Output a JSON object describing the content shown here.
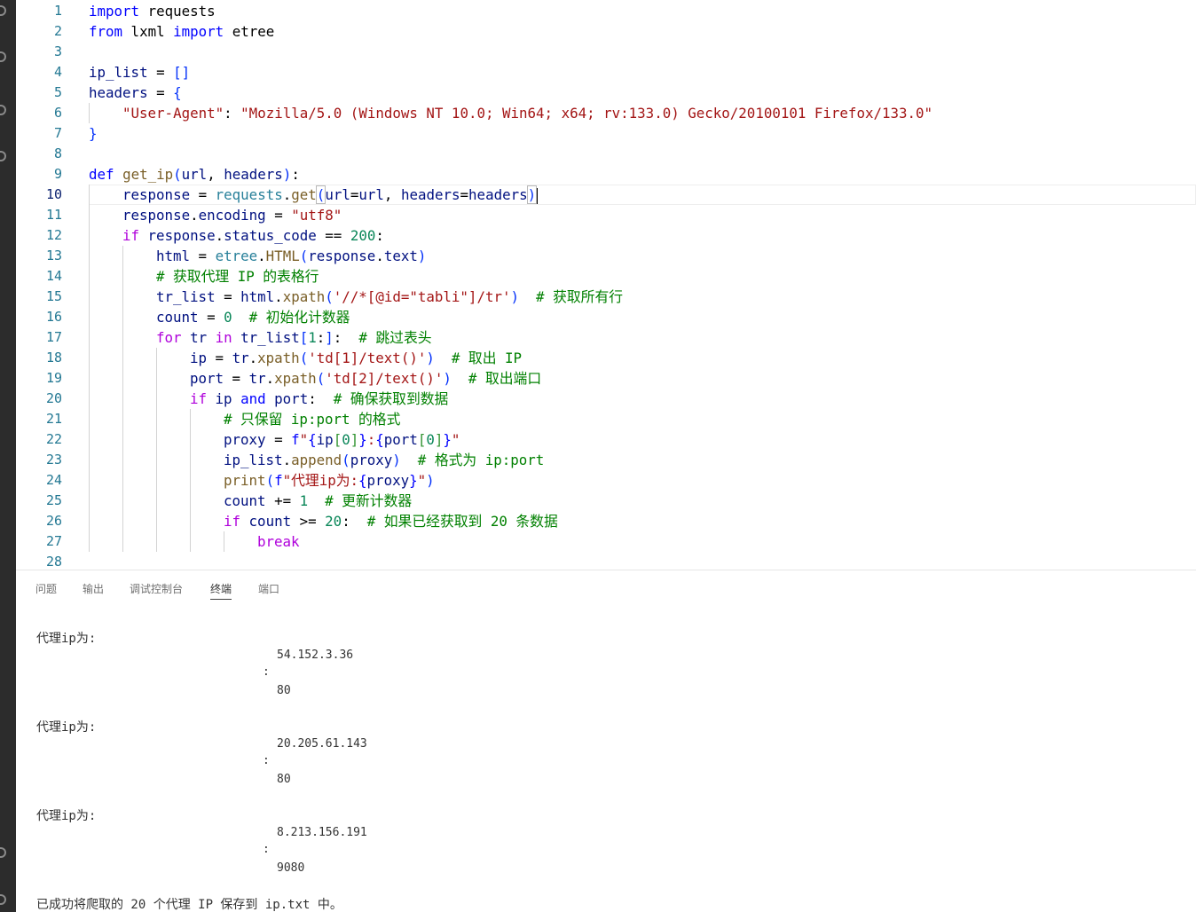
{
  "editor": {
    "active_line": 10,
    "lines": [
      {
        "n": "1",
        "indent": 0,
        "tokens": [
          [
            "kw",
            "import"
          ],
          [
            "",
            " "
          ],
          [
            "",
            "requests"
          ]
        ]
      },
      {
        "n": "2",
        "indent": 0,
        "tokens": [
          [
            "kw",
            "from"
          ],
          [
            "",
            " lxml "
          ],
          [
            "kw",
            "import"
          ],
          [
            "",
            " etree"
          ]
        ]
      },
      {
        "n": "3",
        "indent": 0,
        "tokens": []
      },
      {
        "n": "4",
        "indent": 0,
        "tokens": [
          [
            "var",
            "ip_list"
          ],
          [
            "",
            " = "
          ],
          [
            "br1",
            "[]"
          ]
        ]
      },
      {
        "n": "5",
        "indent": 0,
        "tokens": [
          [
            "var",
            "headers"
          ],
          [
            "",
            " = "
          ],
          [
            "br1",
            "{"
          ]
        ]
      },
      {
        "n": "6",
        "indent": 1,
        "tokens": [
          [
            "str",
            "\"User-Agent\""
          ],
          [
            "",
            ": "
          ],
          [
            "str",
            "\"Mozilla/5.0 (Windows NT 10.0; Win64; x64; rv:133.0) Gecko/20100101 Firefox/133.0\""
          ]
        ]
      },
      {
        "n": "7",
        "indent": 0,
        "tokens": [
          [
            "br1",
            "}"
          ]
        ]
      },
      {
        "n": "8",
        "indent": 0,
        "tokens": []
      },
      {
        "n": "9",
        "indent": 0,
        "tokens": [
          [
            "kw",
            "def"
          ],
          [
            "",
            " "
          ],
          [
            "fn",
            "get_ip"
          ],
          [
            "br1",
            "("
          ],
          [
            "var",
            "url"
          ],
          [
            "",
            ", "
          ],
          [
            "var",
            "headers"
          ],
          [
            "br1",
            ")"
          ],
          [
            "",
            ":"
          ]
        ]
      },
      {
        "n": "10",
        "indent": 1,
        "tokens": [
          [
            "var",
            "response"
          ],
          [
            "",
            " = "
          ],
          [
            "mod",
            "requests"
          ],
          [
            "",
            "."
          ],
          [
            "fn",
            "get"
          ],
          [
            "br1 mbox",
            "("
          ],
          [
            "var",
            "url"
          ],
          [
            "",
            "="
          ],
          [
            "var",
            "url"
          ],
          [
            "",
            ", "
          ],
          [
            "var",
            "headers"
          ],
          [
            "",
            "="
          ],
          [
            "var",
            "headers"
          ],
          [
            "br1 mbox",
            ")"
          ]
        ]
      },
      {
        "n": "11",
        "indent": 1,
        "tokens": [
          [
            "var",
            "response"
          ],
          [
            "",
            "."
          ],
          [
            "var",
            "encoding"
          ],
          [
            "",
            " = "
          ],
          [
            "str",
            "\"utf8\""
          ]
        ]
      },
      {
        "n": "12",
        "indent": 1,
        "tokens": [
          [
            "ctl",
            "if"
          ],
          [
            "",
            " "
          ],
          [
            "var",
            "response"
          ],
          [
            "",
            "."
          ],
          [
            "var",
            "status_code"
          ],
          [
            "",
            " == "
          ],
          [
            "num",
            "200"
          ],
          [
            "",
            ":"
          ]
        ]
      },
      {
        "n": "13",
        "indent": 2,
        "tokens": [
          [
            "var",
            "html"
          ],
          [
            "",
            " = "
          ],
          [
            "mod",
            "etree"
          ],
          [
            "",
            "."
          ],
          [
            "fn",
            "HTML"
          ],
          [
            "br1",
            "("
          ],
          [
            "var",
            "response"
          ],
          [
            "",
            "."
          ],
          [
            "var",
            "text"
          ],
          [
            "br1",
            ")"
          ]
        ]
      },
      {
        "n": "14",
        "indent": 2,
        "tokens": [
          [
            "cmt",
            "# 获取代理 IP 的表格行"
          ]
        ]
      },
      {
        "n": "15",
        "indent": 2,
        "tokens": [
          [
            "var",
            "tr_list"
          ],
          [
            "",
            " = "
          ],
          [
            "var",
            "html"
          ],
          [
            "",
            "."
          ],
          [
            "fn",
            "xpath"
          ],
          [
            "br1",
            "("
          ],
          [
            "str",
            "'//*[@id=\"tabli\"]/tr'"
          ],
          [
            "br1",
            ")"
          ],
          [
            "",
            "  "
          ],
          [
            "cmt",
            "# 获取所有行"
          ]
        ]
      },
      {
        "n": "16",
        "indent": 2,
        "tokens": [
          [
            "var",
            "count"
          ],
          [
            "",
            " = "
          ],
          [
            "num",
            "0"
          ],
          [
            "",
            "  "
          ],
          [
            "cmt",
            "# 初始化计数器"
          ]
        ]
      },
      {
        "n": "17",
        "indent": 2,
        "tokens": [
          [
            "ctl",
            "for"
          ],
          [
            "",
            " "
          ],
          [
            "var",
            "tr"
          ],
          [
            "",
            " "
          ],
          [
            "ctl",
            "in"
          ],
          [
            "",
            " "
          ],
          [
            "var",
            "tr_list"
          ],
          [
            "br1",
            "["
          ],
          [
            "num",
            "1"
          ],
          [
            "",
            ":"
          ],
          [
            "br1",
            "]"
          ],
          [
            "",
            ":  "
          ],
          [
            "cmt",
            "# 跳过表头"
          ]
        ]
      },
      {
        "n": "18",
        "indent": 3,
        "tokens": [
          [
            "var",
            "ip"
          ],
          [
            "",
            " = "
          ],
          [
            "var",
            "tr"
          ],
          [
            "",
            "."
          ],
          [
            "fn",
            "xpath"
          ],
          [
            "br1",
            "("
          ],
          [
            "str",
            "'td[1]/text()'"
          ],
          [
            "br1",
            ")"
          ],
          [
            "",
            "  "
          ],
          [
            "cmt",
            "# 取出 IP"
          ]
        ]
      },
      {
        "n": "19",
        "indent": 3,
        "tokens": [
          [
            "var",
            "port"
          ],
          [
            "",
            " = "
          ],
          [
            "var",
            "tr"
          ],
          [
            "",
            "."
          ],
          [
            "fn",
            "xpath"
          ],
          [
            "br1",
            "("
          ],
          [
            "str",
            "'td[2]/text()'"
          ],
          [
            "br1",
            ")"
          ],
          [
            "",
            "  "
          ],
          [
            "cmt",
            "# 取出端口"
          ]
        ]
      },
      {
        "n": "20",
        "indent": 3,
        "tokens": [
          [
            "ctl",
            "if"
          ],
          [
            "",
            " "
          ],
          [
            "var",
            "ip"
          ],
          [
            "",
            " "
          ],
          [
            "kw",
            "and"
          ],
          [
            "",
            " "
          ],
          [
            "var",
            "port"
          ],
          [
            "",
            ":  "
          ],
          [
            "cmt",
            "# 确保获取到数据"
          ]
        ]
      },
      {
        "n": "21",
        "indent": 4,
        "tokens": [
          [
            "cmt",
            "# 只保留 ip:port 的格式"
          ]
        ]
      },
      {
        "n": "22",
        "indent": 4,
        "tokens": [
          [
            "var",
            "proxy"
          ],
          [
            "",
            " = "
          ],
          [
            "kw",
            "f"
          ],
          [
            "str",
            "\""
          ],
          [
            "kw",
            "{"
          ],
          [
            "var",
            "ip"
          ],
          [
            "br2",
            "["
          ],
          [
            "num",
            "0"
          ],
          [
            "br2",
            "]"
          ],
          [
            "kw",
            "}"
          ],
          [
            "str",
            ":"
          ],
          [
            "kw",
            "{"
          ],
          [
            "var",
            "port"
          ],
          [
            "br2",
            "["
          ],
          [
            "num",
            "0"
          ],
          [
            "br2",
            "]"
          ],
          [
            "kw",
            "}"
          ],
          [
            "str",
            "\""
          ]
        ]
      },
      {
        "n": "23",
        "indent": 4,
        "tokens": [
          [
            "var",
            "ip_list"
          ],
          [
            "",
            "."
          ],
          [
            "fn",
            "append"
          ],
          [
            "br1",
            "("
          ],
          [
            "var",
            "proxy"
          ],
          [
            "br1",
            ")"
          ],
          [
            "",
            "  "
          ],
          [
            "cmt",
            "# 格式为 ip:port"
          ]
        ]
      },
      {
        "n": "24",
        "indent": 4,
        "tokens": [
          [
            "fn",
            "print"
          ],
          [
            "br1",
            "("
          ],
          [
            "kw",
            "f"
          ],
          [
            "str",
            "\"代理ip为:"
          ],
          [
            "kw",
            "{"
          ],
          [
            "var",
            "proxy"
          ],
          [
            "kw",
            "}"
          ],
          [
            "str",
            "\""
          ],
          [
            "br1",
            ")"
          ]
        ]
      },
      {
        "n": "25",
        "indent": 4,
        "tokens": [
          [
            "var",
            "count"
          ],
          [
            "",
            " += "
          ],
          [
            "num",
            "1"
          ],
          [
            "",
            "  "
          ],
          [
            "cmt",
            "# 更新计数器"
          ]
        ]
      },
      {
        "n": "26",
        "indent": 4,
        "tokens": [
          [
            "ctl",
            "if"
          ],
          [
            "",
            " "
          ],
          [
            "var",
            "count"
          ],
          [
            "",
            " >= "
          ],
          [
            "num",
            "20"
          ],
          [
            "",
            ":  "
          ],
          [
            "cmt",
            "# 如果已经获取到 20 条数据"
          ]
        ]
      },
      {
        "n": "27",
        "indent": 5,
        "tokens": [
          [
            "ctl",
            "break"
          ]
        ]
      },
      {
        "n": "28",
        "indent": 0,
        "tokens": []
      }
    ]
  },
  "panel": {
    "tabs": [
      "问题",
      "输出",
      "调试控制台",
      "终端",
      "端口"
    ],
    "active_tab": "终端"
  },
  "terminal": {
    "entries": [
      {
        "label": "代理ip为:",
        "ip": "54.152.3.36",
        "colon": ":",
        "port": "80"
      },
      {
        "label": "代理ip为:",
        "ip": "20.205.61.143",
        "colon": ":",
        "port": "80"
      },
      {
        "label": "代理ip为:",
        "ip": "8.213.156.191",
        "colon": ":",
        "port": "9080"
      }
    ],
    "final_message": "已成功将爬取的 20 个代理 IP 保存到 ip.txt 中。"
  }
}
